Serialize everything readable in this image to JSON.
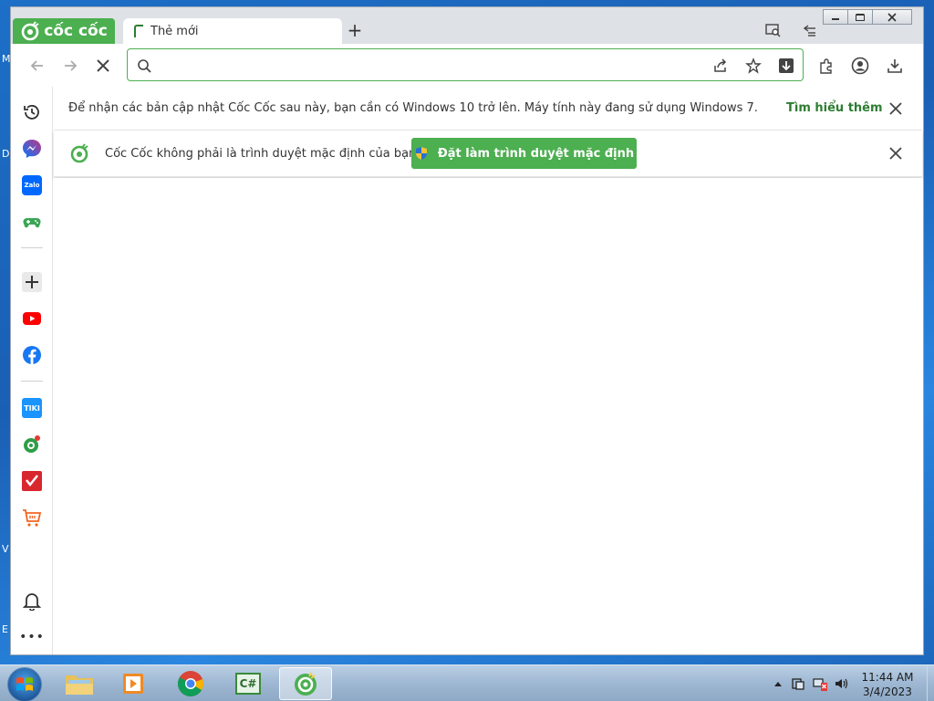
{
  "desktop": {
    "edge_letters": [
      "M",
      "D",
      "V",
      "E"
    ]
  },
  "browser": {
    "logo_text": "cốc cốc",
    "tabs": [
      {
        "label": "Thẻ mới"
      }
    ],
    "newtab_label": "+",
    "address": {
      "value": "",
      "placeholder": ""
    }
  },
  "sidebar": {
    "items": [
      {
        "name": "history",
        "icon": "history-icon"
      },
      {
        "name": "messenger",
        "icon": "messenger-icon"
      },
      {
        "name": "zalo",
        "icon": "zalo-icon",
        "label": "Zalo"
      },
      {
        "name": "games",
        "icon": "gamepad-icon"
      },
      {
        "name": "add",
        "icon": "plus-icon"
      },
      {
        "name": "youtube",
        "icon": "youtube-icon"
      },
      {
        "name": "facebook",
        "icon": "facebook-icon"
      },
      {
        "name": "tiki",
        "icon": "tiki-icon",
        "label": "TIKI"
      },
      {
        "name": "football",
        "icon": "football-icon"
      },
      {
        "name": "tick",
        "icon": "tick-app-icon"
      },
      {
        "name": "cart",
        "icon": "shopping-cart-icon"
      },
      {
        "name": "notifications",
        "icon": "bell-icon"
      },
      {
        "name": "more",
        "icon": "more-icon",
        "label": "•••"
      }
    ]
  },
  "infobars": {
    "update": {
      "text": "Để nhận các bản cập nhật Cốc Cốc sau này, bạn cần có Windows 10 trở lên. Máy tính này đang sử dụng Windows 7.",
      "link": "Tìm hiểu thêm",
      "close": "✕"
    },
    "default_browser": {
      "text": "Cốc Cốc không phải là trình duyệt mặc định của bạn",
      "button": "Đặt làm trình duyệt mặc định",
      "close": "✕"
    }
  },
  "taskbar": {
    "apps": [
      "explorer",
      "media-player",
      "chrome",
      "csharp-ide",
      "coccoc"
    ],
    "csharp_label": "C#",
    "clock": {
      "time": "11:44 AM",
      "date": "3/4/2023"
    }
  },
  "colors": {
    "brand_green": "#4caf50",
    "link_green": "#2e7d32"
  }
}
